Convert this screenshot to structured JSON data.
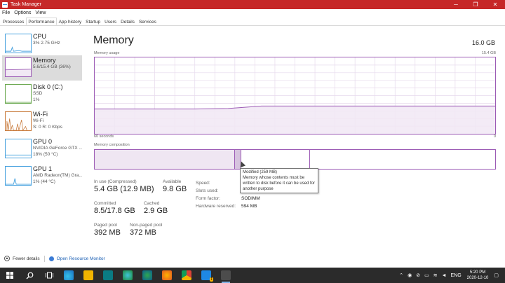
{
  "window": {
    "title": "Task Manager",
    "minimize": "─",
    "maximize": "❐",
    "close": "✕"
  },
  "menu": [
    "File",
    "Options",
    "View"
  ],
  "tabs": [
    "Processes",
    "Performance",
    "App history",
    "Startup",
    "Users",
    "Details",
    "Services"
  ],
  "sidebar": [
    {
      "title": "CPU",
      "sub1": "3%  2.75 GHz",
      "sub2": ""
    },
    {
      "title": "Memory",
      "sub1": "5.6/15.4 GB (36%)",
      "sub2": ""
    },
    {
      "title": "Disk 0 (C:)",
      "sub1": "SSD",
      "sub2": "1%"
    },
    {
      "title": "Wi-Fi",
      "sub1": "Wi-Fi",
      "sub2": "S: 0  R: 0 Kbps"
    },
    {
      "title": "GPU 0",
      "sub1": "NVIDIA GeForce GTX ...",
      "sub2": "18% (50 °C)"
    },
    {
      "title": "GPU 1",
      "sub1": "AMD Radeon(TM) Gra...",
      "sub2": "1% (44 °C)"
    }
  ],
  "main": {
    "title": "Memory",
    "total": "16.0 GB",
    "usage_label": "Memory usage",
    "usage_max": "15.4 GB",
    "time_left": "60 seconds",
    "time_right": "0",
    "composition_label": "Memory composition",
    "tooltip": {
      "title": "Modified (259 MB)",
      "body": "Memory whose contents must be written to disk before it can be used for another purpose"
    },
    "stats": {
      "inuse_label": "In use (Compressed)",
      "inuse_value": "5.4 GB (12.9 MB)",
      "available_label": "Available",
      "available_value": "9.8 GB",
      "committed_label": "Committed",
      "committed_value": "8.5/17.8 GB",
      "cached_label": "Cached",
      "cached_value": "2.9 GB",
      "paged_label": "Paged pool",
      "paged_value": "392 MB",
      "nonpaged_label": "Non-paged pool",
      "nonpaged_value": "372 MB"
    },
    "hw": {
      "speed_label": "Speed:",
      "speed_value": "",
      "slots_label": "Slots used:",
      "slots_value": "",
      "form_label": "Form factor:",
      "form_value": "SODIMM",
      "reserved_label": "Hardware reserved:",
      "reserved_value": "594 MB"
    }
  },
  "footer": {
    "fewer": "Fewer details",
    "open_res": "Open Resource Monitor"
  },
  "taskbar": {
    "lang": "ENG",
    "time": "5:20 PM",
    "date": "2020-12-10",
    "badge": "1"
  },
  "chart_data": {
    "type": "area",
    "title": "Memory usage",
    "x_label_left": "60 seconds",
    "x_label_right": "0",
    "ylim": [
      0,
      15.4
    ],
    "y_unit": "GB",
    "x": [
      60,
      50,
      45,
      40,
      35,
      30,
      20,
      10,
      0
    ],
    "values": [
      5.0,
      5.0,
      5.0,
      5.1,
      5.6,
      5.6,
      5.6,
      5.6,
      5.6
    ],
    "grid": true,
    "colors": {
      "line": "#9c5bb5",
      "fill": "#f1e8f4",
      "grid": "#e6d9ec"
    }
  }
}
